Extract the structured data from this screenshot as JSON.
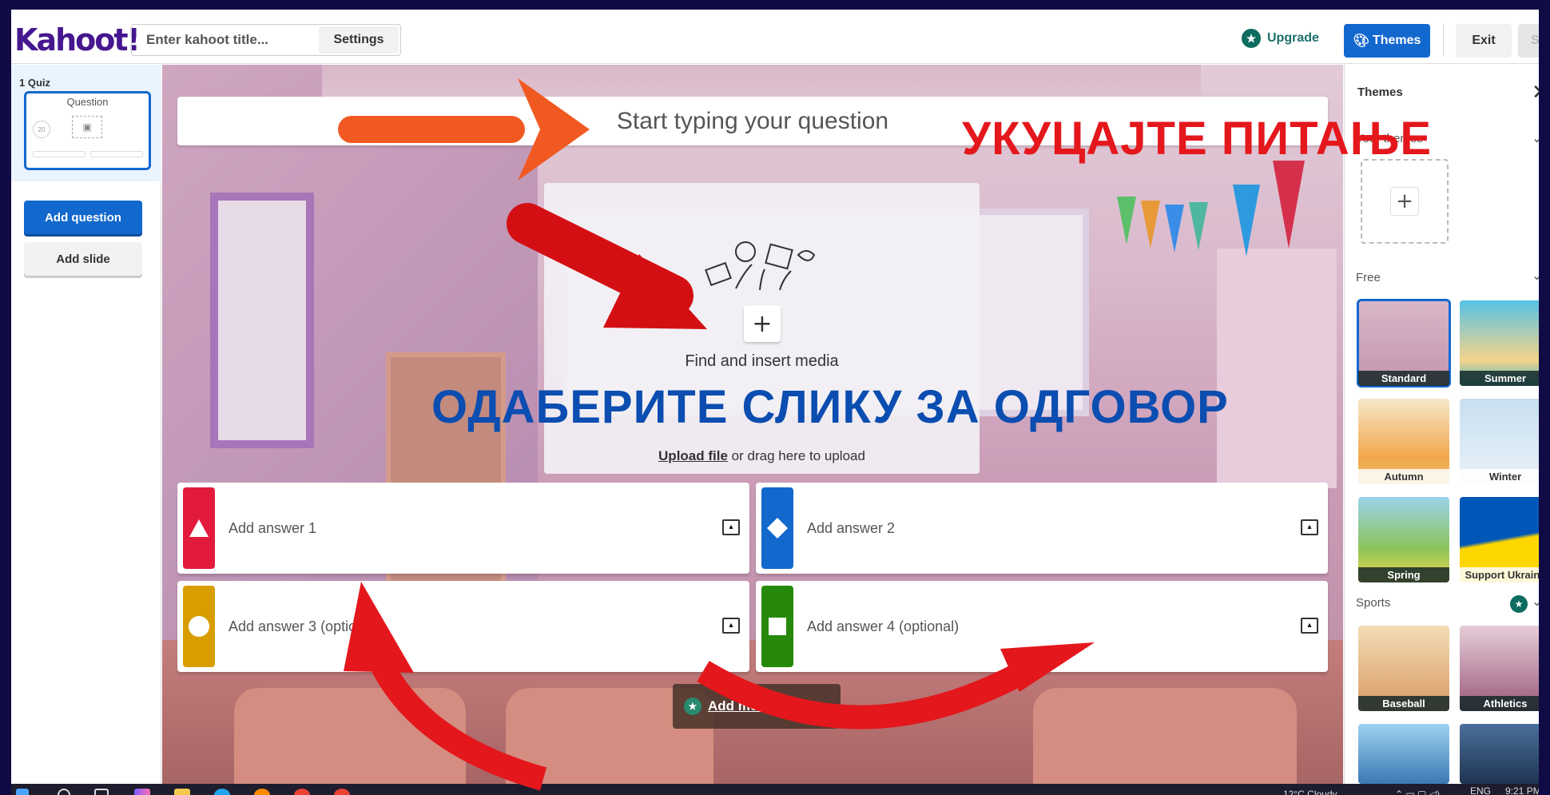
{
  "header": {
    "logo": "Kahoot!",
    "title_placeholder": "Enter kahoot title...",
    "settings_label": "Settings",
    "upgrade_label": "Upgrade",
    "themes_label": "Themes",
    "exit_label": "Exit",
    "save_label": "Save"
  },
  "sidebar": {
    "slide_label": "1  Quiz",
    "thumb_title": "Question",
    "thumb_timer": "20",
    "add_question": "Add question",
    "add_slide": "Add slide"
  },
  "editor": {
    "question_placeholder": "Start typing your question",
    "media_find": "Find and insert media",
    "upload_link": "Upload file",
    "upload_rest": " or drag here to upload",
    "answers": [
      {
        "placeholder": "Add answer 1",
        "color": "#e21b3c",
        "shape": "triangle"
      },
      {
        "placeholder": "Add answer 2",
        "color": "#1368ce",
        "shape": "diamond"
      },
      {
        "placeholder": "Add answer 3 (optional)",
        "color": "#d89e00",
        "shape": "circle"
      },
      {
        "placeholder": "Add answer 4 (optional)",
        "color": "#26890c",
        "shape": "square"
      }
    ],
    "add_more_answers": "Add more answers"
  },
  "themes_panel": {
    "title": "Themes",
    "section_custom": "Your themes",
    "section_free": "Free",
    "section_sports": "Sports",
    "tiles": [
      {
        "name": "Standard",
        "selected": true
      },
      {
        "name": "Summer",
        "selected": false
      },
      {
        "name": "Autumn",
        "selected": false
      },
      {
        "name": "Winter",
        "selected": false
      },
      {
        "name": "Spring",
        "selected": false
      },
      {
        "name": "Support Ukraine",
        "selected": false
      },
      {
        "name": "Baseball",
        "selected": false
      },
      {
        "name": "Athletics",
        "selected": false
      }
    ]
  },
  "taskbar": {
    "weather": "12°C  Cloudy",
    "lang": "ENG",
    "time": "9:21 PM"
  },
  "annotations": {
    "type_question": "УКУЦАЈТЕ ПИТАЊЕ",
    "choose_image": "ОДАБЕРИТЕ СЛИКУ ЗА ОДГОВОР"
  },
  "colors": {
    "brand_purple": "#46178f",
    "primary_blue": "#1368ce",
    "annotation_red": "#e4171c",
    "annotation_blue": "#0b4db0"
  }
}
